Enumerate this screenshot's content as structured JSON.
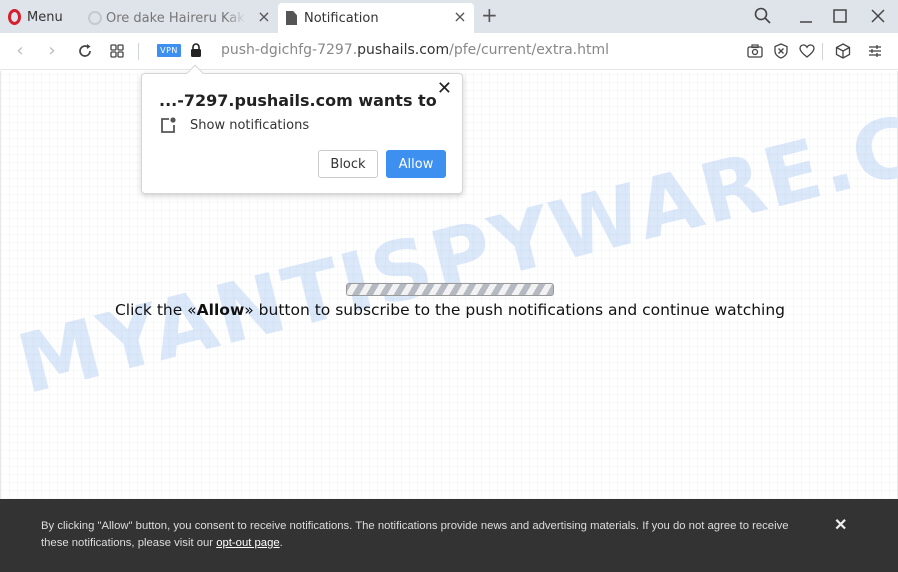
{
  "browser": {
    "menu_label": "Menu",
    "tabs": [
      {
        "title": "Ore dake Haireru Kakushi Dungeon",
        "icon": "loading-spinner-icon",
        "active": false
      },
      {
        "title": "Notification",
        "icon": "document-icon",
        "active": true
      }
    ],
    "new_tab_label": "+",
    "vpn_badge": "VPN",
    "url": {
      "prefix": "push-dgichfg-7297.",
      "host": "pushails.com",
      "path": "/pfe/current/extra.html"
    },
    "accent_color": "#3d8ff0"
  },
  "popup": {
    "title": "...-7297.pushails.com wants to",
    "permission": "Show notifications",
    "block_label": "Block",
    "allow_label": "Allow",
    "close_label": "✕"
  },
  "page": {
    "watermark": "MYANTISPYWARE.COM",
    "message_before": "Click the «",
    "message_bold": "Allow",
    "message_after": "» button to subscribe to the push notifications and continue watching"
  },
  "consent": {
    "text": "By clicking \"Allow\" button, you consent to receive notifications. The notifications provide news and advertising materials. If you do not agree to receive these notifications, please visit our ",
    "link": "opt-out page",
    "suffix": ".",
    "close_label": "✕",
    "background": "#333333"
  }
}
